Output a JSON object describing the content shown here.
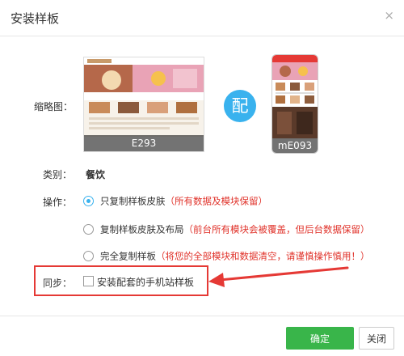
{
  "dialog": {
    "title": "安装样板",
    "close_symbol": "×"
  },
  "thumbnail": {
    "label": "缩略图：",
    "pc_template_code": "E293",
    "connector_text": "配",
    "mobile_template_code": "mE093"
  },
  "category": {
    "label": "类别：",
    "value": "餐饮"
  },
  "operation": {
    "label": "操作：",
    "options": [
      {
        "text": "只复制样板皮肤",
        "note": "（所有数据及模块保留）",
        "selected": true
      },
      {
        "text": "复制样板皮肤及布局",
        "note": "（前台所有模块会被覆盖，但后台数据保留）",
        "selected": false
      },
      {
        "text": "完全复制样板",
        "note": "（将您的全部模块和数据清空，请谨慎操作慎用！）",
        "selected": false
      }
    ]
  },
  "sync": {
    "label": "同步：",
    "checkbox_text": "安装配套的手机站样板",
    "checked": false
  },
  "footer": {
    "ok_label": "确定",
    "close_label": "关闭"
  },
  "colors": {
    "accent_blue": "#39b2ee",
    "ok_green": "#39b54a",
    "warning_red": "#e0322a",
    "highlight_red": "#e53935"
  },
  "icons": {
    "close": "close-icon",
    "radio": "radio-icon",
    "checkbox": "checkbox-icon",
    "arrow": "annotation-arrow-icon"
  }
}
